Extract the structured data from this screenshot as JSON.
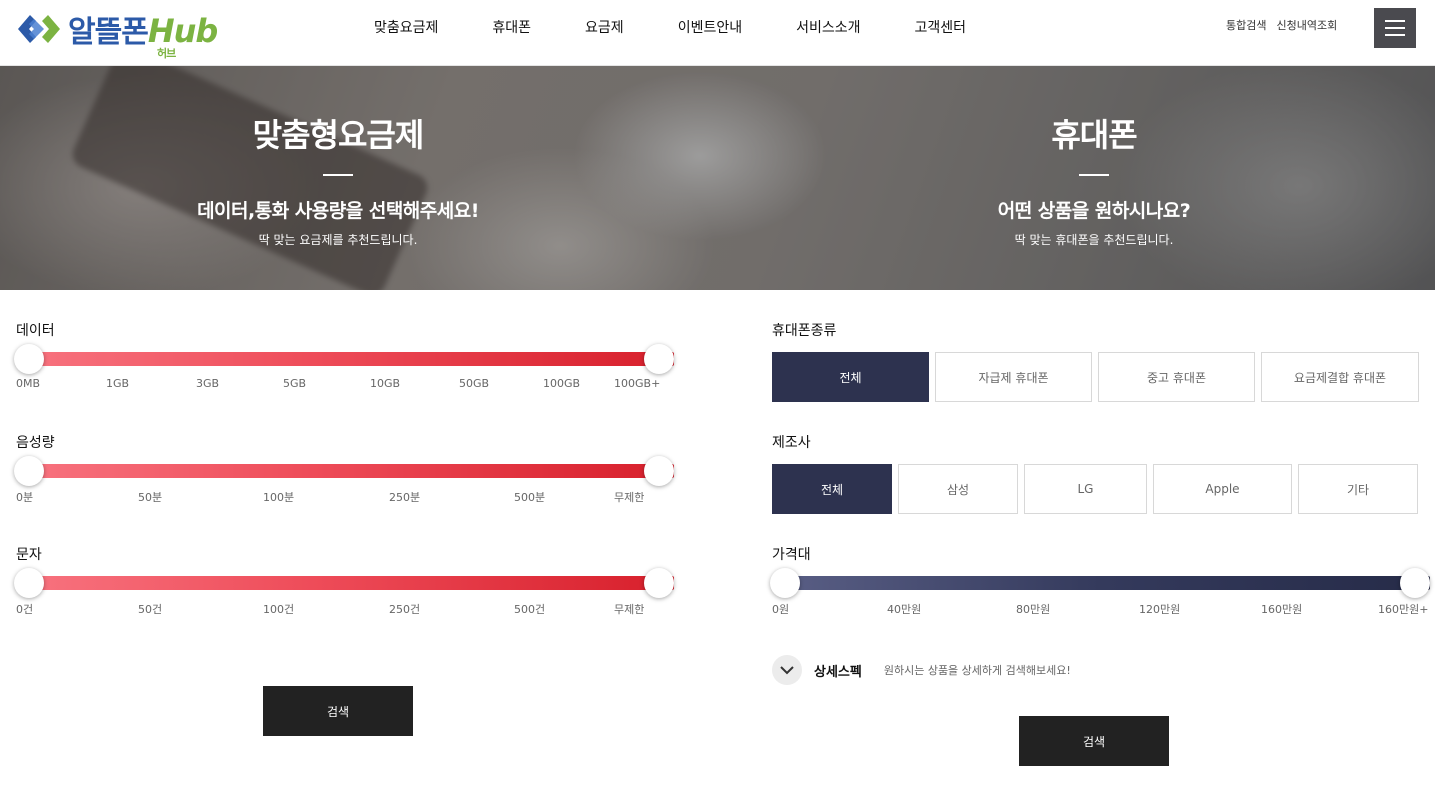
{
  "brand": {
    "logo_text": "알뜰폰",
    "logo_hub": "Hub",
    "logo_sub": "허브",
    "colors": {
      "primary": "#2c5aa8",
      "accent": "#7cb342"
    }
  },
  "nav": {
    "items": [
      {
        "label": "맞춤요금제"
      },
      {
        "label": "휴대폰"
      },
      {
        "label": "요금제"
      },
      {
        "label": "이벤트안내"
      },
      {
        "label": "서비스소개"
      },
      {
        "label": "고객센터"
      }
    ]
  },
  "util": {
    "search": "통합검색",
    "history": "신청내역조회",
    "menu_icon": "hamburger-icon"
  },
  "hero": {
    "left": {
      "title": "맞춤형요금제",
      "subtitle": "데이터,통화 사용량을 선택해주세요!",
      "desc": "딱 맞는 요금제를 추천드립니다."
    },
    "right": {
      "title": "휴대폰",
      "subtitle": "어떤 상품을 원하시나요?",
      "desc": "딱 맞는 휴대폰을 추천드립니다."
    }
  },
  "plan": {
    "data": {
      "label": "데이터",
      "ticks": [
        "0MB",
        "1GB",
        "3GB",
        "5GB",
        "10GB",
        "50GB",
        "100GB",
        "100GB+"
      ]
    },
    "voice": {
      "label": "음성량",
      "ticks": [
        "0분",
        "50분",
        "100분",
        "250분",
        "500분",
        "무제한"
      ]
    },
    "sms": {
      "label": "문자",
      "ticks": [
        "0건",
        "50건",
        "100건",
        "250건",
        "500건",
        "무제한"
      ]
    },
    "search_label": "검색",
    "slider_color": "#d71f2b"
  },
  "phone": {
    "type": {
      "label": "휴대폰종류",
      "options": [
        "전체",
        "자급제 휴대폰",
        "중고 휴대폰",
        "요금제결합 휴대폰"
      ],
      "selected": "전체"
    },
    "maker": {
      "label": "제조사",
      "options": [
        "전체",
        "삼성",
        "LG",
        "Apple",
        "기타"
      ],
      "selected": "전체"
    },
    "price": {
      "label": "가격대",
      "ticks": [
        "0원",
        "40만원",
        "80만원",
        "120만원",
        "160만원",
        "160만원+"
      ]
    },
    "detail": {
      "title": "상세스펙",
      "desc": "원하시는 상품을 상세하게 검색해보세요!"
    },
    "search_label": "검색",
    "active_color": "#2d324f"
  }
}
